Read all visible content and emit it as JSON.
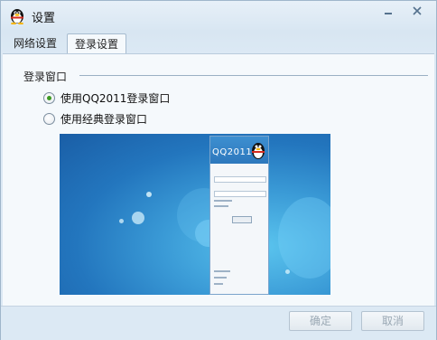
{
  "window": {
    "title": "设置"
  },
  "tabs": [
    {
      "label": "网络设置"
    },
    {
      "label": "登录设置"
    }
  ],
  "login_window": {
    "section_title": "登录窗口",
    "options": [
      {
        "label": "使用QQ2011登录窗口",
        "checked": true
      },
      {
        "label": "使用经典登录窗口",
        "checked": false
      }
    ],
    "preview": {
      "logo_text": "QQ2011"
    }
  },
  "buttons": {
    "ok": "确定",
    "cancel": "取消"
  },
  "colors": {
    "accent": "#3e9a24",
    "preview_bg": "#2376be",
    "disabled_text": "#9aa8b4"
  }
}
